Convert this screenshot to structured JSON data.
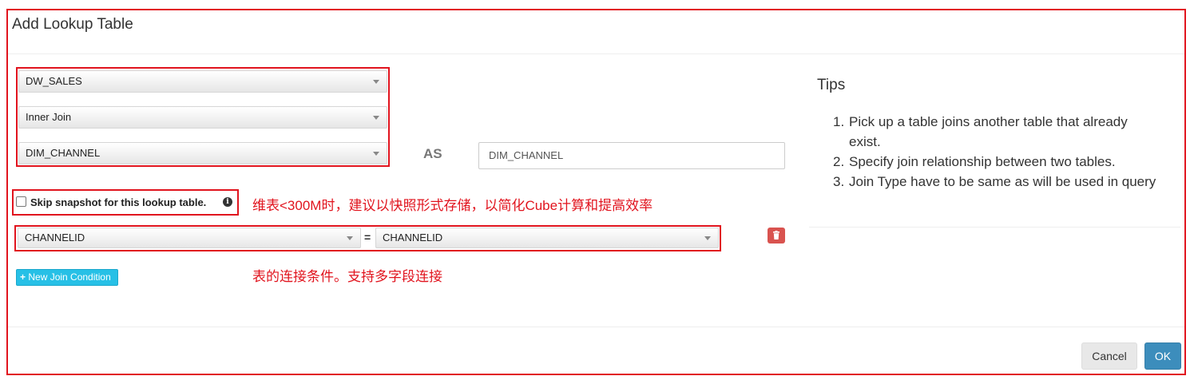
{
  "dialog": {
    "title": "Add Lookup Table"
  },
  "form": {
    "fact_table": "DW_SALES",
    "join_type": "Inner Join",
    "lookup_table": "DIM_CHANNEL",
    "as_label": "AS",
    "alias_value": "DIM_CHANNEL",
    "skip_snapshot_label": "Skip snapshot for this lookup table.",
    "info_glyph": "i"
  },
  "annotations": {
    "snapshot_note": "维表<300M时，建议以快照形式存储，以简化Cube计算和提高效率",
    "join_note": "表的连接条件。支持多字段连接"
  },
  "join_condition": {
    "left_column": "CHANNELID",
    "operator": "=",
    "right_column": "CHANNELID",
    "new_button_label": "New Join Condition",
    "new_button_icon": "+"
  },
  "tips": {
    "title": "Tips",
    "items": [
      "Pick up a table joins another table that already exist.",
      "Specify join relationship between two tables.",
      "Join Type have to be same as will be used in query"
    ]
  },
  "footer": {
    "cancel_label": "Cancel",
    "ok_label": "OK"
  },
  "colors": {
    "annotation_red": "#e1141e",
    "primary": "#3c8dbc",
    "info_button": "#27c0e6",
    "danger": "#d9534f"
  },
  "icons": {
    "delete": "trash-icon",
    "add": "plus-icon",
    "info": "info-circle-icon",
    "dropdown": "caret-down-icon"
  }
}
